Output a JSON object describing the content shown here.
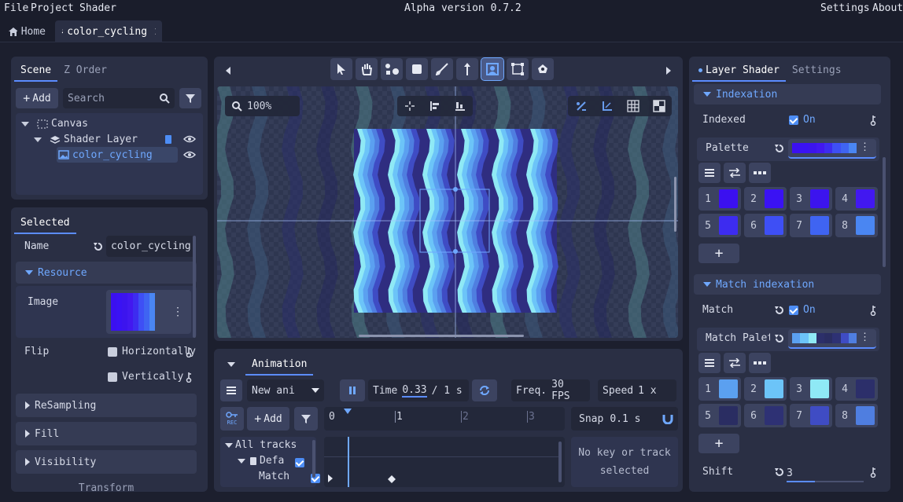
{
  "menubar": {
    "items": [
      "File",
      "Project",
      "Shader"
    ],
    "version": "Alpha version 0.7.2",
    "right_items": [
      "Settings",
      "About"
    ]
  },
  "tabs": [
    {
      "label": "Home",
      "icon": "home-icon"
    },
    {
      "label": "color_cycling",
      "icon": "layers-icon",
      "active": true
    }
  ],
  "scene_panel": {
    "tabs": [
      "Scene",
      "Z Order"
    ],
    "add_label": "Add",
    "search_placeholder": "Search",
    "tree": [
      {
        "label": "Canvas",
        "icon": "canvas-icon"
      },
      {
        "label": "Shader Layer",
        "icon": "layers-icon"
      },
      {
        "label": "color_cycling",
        "icon": "image-icon",
        "selected": true
      }
    ]
  },
  "selected_panel": {
    "tab": "Selected",
    "name_label": "Name",
    "name_value": "color_cycling",
    "resource_label": "Resource",
    "image_label": "Image",
    "flip_label": "Flip",
    "flip_h": "Horizontally",
    "flip_v": "Vertically",
    "sections": [
      "ReSampling",
      "Fill",
      "Visibility"
    ],
    "cut_section": "Transform"
  },
  "viewport": {
    "zoom": "100%",
    "tools": [
      "select-icon",
      "pan-icon",
      "nodes-icon",
      "square-icon",
      "brush-icon",
      "pin-icon",
      "frame-icon",
      "crop-icon",
      "sprite-icon"
    ]
  },
  "animation": {
    "tab": "Animation",
    "anim_name": "New ani",
    "time_label": "Time",
    "time_value": "0.33",
    "time_total": "/ 1 s",
    "freq_label": "Freq.",
    "freq_value": "30 FPS",
    "speed_label": "Speed",
    "speed_value": "1 x",
    "add_label": "Add",
    "rec_label": "REC",
    "ruler": [
      "0",
      "1",
      "2",
      "3"
    ],
    "snap_label": "Snap",
    "snap_value": "0.1 s",
    "tracks_label": "All tracks",
    "track_default": "Defa",
    "track_match": "Match",
    "no_key_text": "No key or track selected"
  },
  "right_panel": {
    "tabs": [
      "Layer Shader",
      "Settings"
    ],
    "indexation": {
      "title": "Indexation",
      "indexed_label": "Indexed",
      "indexed_value": "On",
      "palette_label": "Palette",
      "swatches": [
        {
          "n": "1",
          "color": "#3b10f0"
        },
        {
          "n": "2",
          "color": "#3a12f4"
        },
        {
          "n": "3",
          "color": "#3c14ee"
        },
        {
          "n": "4",
          "color": "#4218f0"
        },
        {
          "n": "5",
          "color": "#3d2cf0"
        },
        {
          "n": "6",
          "color": "#3e4ff5"
        },
        {
          "n": "7",
          "color": "#3f64f2"
        },
        {
          "n": "8",
          "color": "#4a86f2"
        }
      ]
    },
    "match": {
      "title": "Match indexation",
      "match_label": "Match",
      "match_value": "On",
      "palette_label": "Match Palette",
      "swatches": [
        {
          "n": "1",
          "color": "#5ba0f0"
        },
        {
          "n": "2",
          "color": "#6cc4f8"
        },
        {
          "n": "3",
          "color": "#8fe9f5"
        },
        {
          "n": "4",
          "color": "#2c2f6a"
        },
        {
          "n": "5",
          "color": "#2a2d62"
        },
        {
          "n": "6",
          "color": "#2e3174"
        },
        {
          "n": "7",
          "color": "#3f4cc4"
        },
        {
          "n": "8",
          "color": "#4f7ee0"
        }
      ]
    },
    "shift_label": "Shift",
    "shift_value": "3"
  },
  "colors": {
    "accent": "#5b8cff",
    "panel": "#2a2f44",
    "bg": "#1c1f2e"
  }
}
